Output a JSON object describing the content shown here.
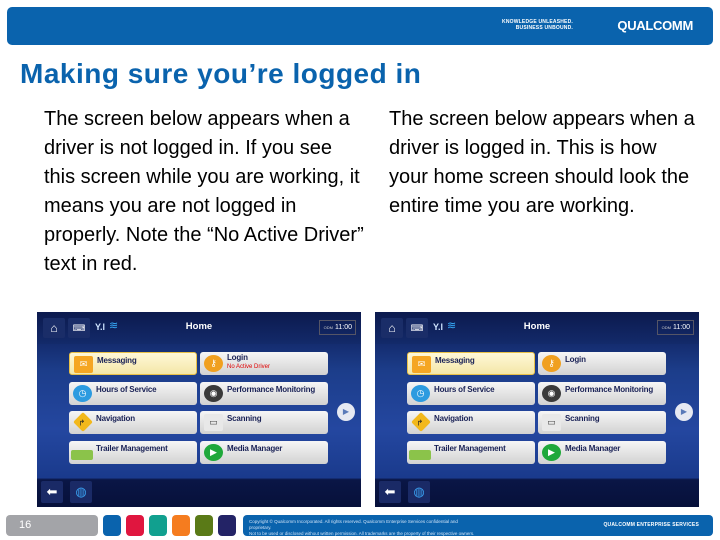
{
  "header": {
    "tagline_line1": "KNOWLEDGE UNLEASHED.",
    "tagline_line2": "BUSINESS UNBOUND.",
    "logo": "QUALCOMM",
    "bar_color": "#0a63ad"
  },
  "page_title": "Making sure you’re logged in",
  "left_column": {
    "text": "The screen below appears when a driver is not logged in. If you see this screen while you are working, it means you are not logged in properly. Note the “No Active Driver” text in red."
  },
  "right_column": {
    "text": "The screen below appears when a driver is logged in. This is how your home screen should look the entire time you are working."
  },
  "screens": {
    "left": {
      "title": "Home",
      "clock_prefix": "ODM",
      "clock": "11:00",
      "tiles": {
        "messaging": "Messaging",
        "login": "Login",
        "login_status": "No Active Driver",
        "hours": "Hours of Service",
        "performance": "Performance Monitoring",
        "navigation": "Navigation",
        "scanning": "Scanning",
        "trailer": "Trailer Management",
        "media": "Media Manager"
      }
    },
    "right": {
      "title": "Home",
      "clock_prefix": "ODM",
      "clock": "11:00",
      "tiles": {
        "messaging": "Messaging",
        "login": "Login",
        "hours": "Hours of Service",
        "performance": "Performance Monitoring",
        "navigation": "Navigation",
        "scanning": "Scanning",
        "trailer": "Trailer Management",
        "media": "Media Manager"
      }
    },
    "icons": {
      "home": "⌂",
      "keyboard": "⌨",
      "signal": "Y.l",
      "wifi": "≋",
      "messaging": "✉",
      "key": "⚷",
      "clock": "◷",
      "gauge": "◉",
      "navigation": "↱",
      "printer": "▭",
      "trailer": "",
      "play": "▶",
      "next": "▶",
      "back": "⬅",
      "globe": "◍"
    }
  },
  "footer": {
    "page_number": "16",
    "swatches": [
      "#0a63ad",
      "#e0163f",
      "#11a08f",
      "#f57c1f",
      "#5a7a17",
      "#232366"
    ],
    "copyright_line1": "Copyright © Qualcomm Incorporated. All rights reserved. Qualcomm Enterprise Services confidential and proprietary.",
    "copyright_line2": "Not to be used or disclosed without written permission. All trademarks are the property of their respective owners.",
    "brand": "QUALCOMM ENTERPRISE SERVICES"
  }
}
